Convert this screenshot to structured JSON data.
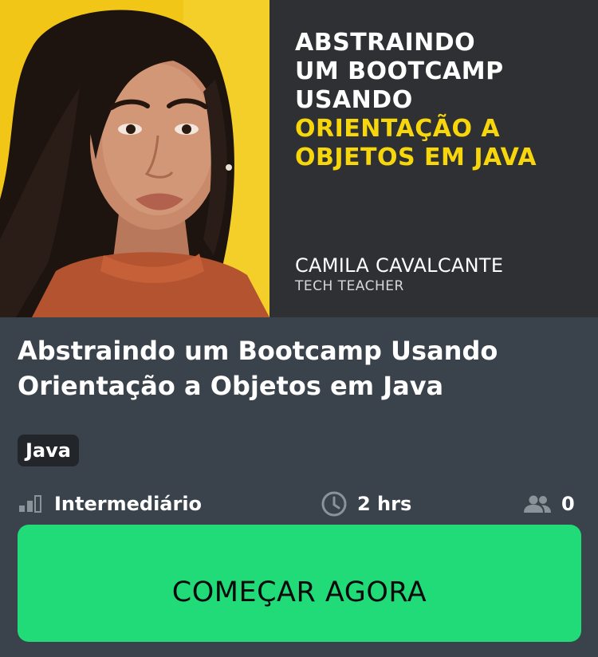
{
  "banner": {
    "headline_white": [
      "ABSTRAINDO",
      "UM BOOTCAMP",
      "USANDO"
    ],
    "headline_yellow": [
      "ORIENTAÇÃO A",
      "OBJETOS EM JAVA"
    ],
    "instructor_name": "CAMILA CAVALCANTE",
    "instructor_role": "TECH TEACHER"
  },
  "course": {
    "title": "Abstraindo um Bootcamp Usando Orientação a Objetos em Java",
    "tag": "Java",
    "level": "Intermediário",
    "duration": "2 hrs",
    "students": "0"
  },
  "cta": {
    "label": "COMEÇAR AGORA"
  },
  "icons": {
    "level": "signal-bars-icon",
    "duration": "clock-icon",
    "students": "people-icon"
  },
  "colors": {
    "card_background": "#3a434c",
    "banner_background": "#2e3033",
    "banner_accent": "#f7d70c",
    "tag_background": "#22262b",
    "cta_background": "#21db79",
    "icon_gray": "#8a929a"
  }
}
